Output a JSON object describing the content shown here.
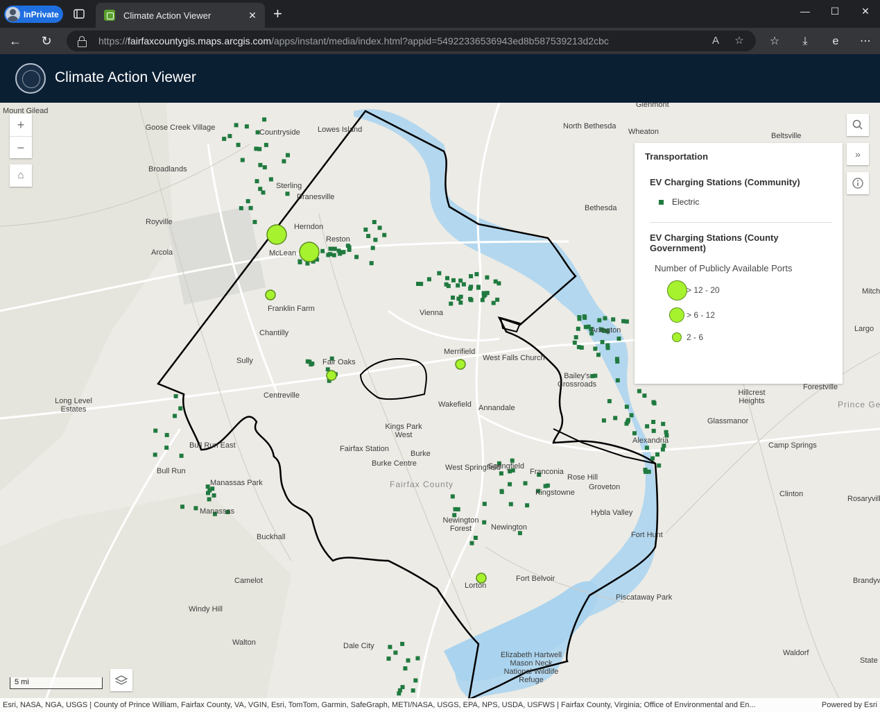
{
  "browser": {
    "inprivate_label": "InPrivate",
    "tab_title": "Climate Action Viewer",
    "url_prefix": "https://",
    "url_host": "fairfaxcountygis.maps.arcgis.com",
    "url_path": "/apps/instant/media/index.html?appid=54922336536943ed8b587539213d2cbc"
  },
  "app": {
    "title": "Climate Action Viewer"
  },
  "legend": {
    "heading": "Transportation",
    "layer1_title": "EV Charging Stations (Community)",
    "layer1_item": "Electric",
    "layer2_title": "EV Charging Stations (County Government)",
    "ports_title": "Number of Publicly Available Ports",
    "classes": [
      "> 12 - 20",
      "> 6 - 12",
      "2 - 6"
    ],
    "symbol_color": "#a6f22e",
    "community_color": "#207a3f"
  },
  "map": {
    "places": [
      {
        "t": "Mount Gilead"
      },
      {
        "t": "Goose Creek Village"
      },
      {
        "t": "Countryside"
      },
      {
        "t": "Lowes Island"
      },
      {
        "t": "Broadlands"
      },
      {
        "t": "Sterling"
      },
      {
        "t": "Dranesville"
      },
      {
        "t": "Royville"
      },
      {
        "t": "Herndon"
      },
      {
        "t": "Reston"
      },
      {
        "t": "Arcola"
      },
      {
        "t": "McLean"
      },
      {
        "t": "Franklin Farm"
      },
      {
        "t": "Chantilly"
      },
      {
        "t": "Vienna"
      },
      {
        "t": "Sully"
      },
      {
        "t": "Fair Oaks"
      },
      {
        "t": "Merrifield"
      },
      {
        "t": "West Falls Church"
      },
      {
        "t": "Centreville"
      },
      {
        "t": "Long Level Estates"
      },
      {
        "t": "Wakefield"
      },
      {
        "t": "Annandale"
      },
      {
        "t": "Kings Park West"
      },
      {
        "t": "Bull Run East"
      },
      {
        "t": "Fairfax Station"
      },
      {
        "t": "Burke"
      },
      {
        "t": "Burke Centre"
      },
      {
        "t": "Bull Run"
      },
      {
        "t": "Manassas Park"
      },
      {
        "t": "West Springfield"
      },
      {
        "t": "Springfield"
      },
      {
        "t": "Franconia"
      },
      {
        "t": "Rose Hill"
      },
      {
        "t": "Groveton"
      },
      {
        "t": "Kingstowne"
      },
      {
        "t": "Manassas"
      },
      {
        "t": "Newington Forest"
      },
      {
        "t": "Hybla Valley"
      },
      {
        "t": "Buckhall"
      },
      {
        "t": "Newington"
      },
      {
        "t": "Fort Hunt"
      },
      {
        "t": "Fort Belvoir"
      },
      {
        "t": "Camelot"
      },
      {
        "t": "Lorton"
      },
      {
        "t": "Piscataway Park"
      },
      {
        "t": "Windy Hill"
      },
      {
        "t": "Walton"
      },
      {
        "t": "Dale City"
      },
      {
        "t": "Elizabeth Hartwell Mason Neck National Wildlife Refuge"
      },
      {
        "t": "Waldorf"
      },
      {
        "t": "Glenmont"
      },
      {
        "t": "North Bethesda"
      },
      {
        "t": "Wheaton"
      },
      {
        "t": "Beltsville"
      },
      {
        "t": "Bethesda"
      },
      {
        "t": "Arlington"
      },
      {
        "t": "Bailey's Crossroads"
      },
      {
        "t": "Alexandria"
      },
      {
        "t": "Hillcrest Heights"
      },
      {
        "t": "Glassmanor"
      },
      {
        "t": "Forestville"
      },
      {
        "t": "Camp Springs"
      },
      {
        "t": "Clinton"
      },
      {
        "t": "Rosaryville"
      },
      {
        "t": "Largo"
      },
      {
        "t": "Mitch"
      },
      {
        "t": "Prince George's"
      },
      {
        "t": "Fairfax County"
      },
      {
        "t": "Brandywi"
      },
      {
        "t": "State"
      }
    ],
    "scale_label": "5 mi",
    "attribution": "Esri, NASA, NGA, USGS | County of Prince William, Fairfax County, VA, VGIN, Esri, TomTom, Garmin, SafeGraph, METI/NASA, USGS, EPA, NPS, USDA, USFWS | Fairfax County, Virginia; Office of Environmental and En...",
    "powered_by": "Powered by Esri"
  }
}
